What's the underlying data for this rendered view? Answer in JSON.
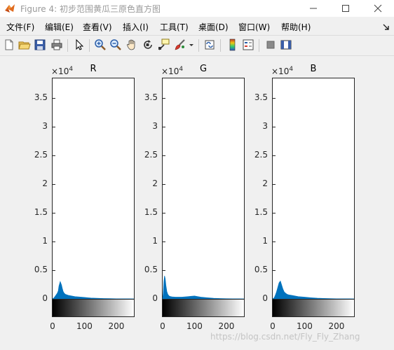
{
  "window": {
    "title": "Figure 4: 初步范围黄瓜三原色直方图"
  },
  "menu": [
    {
      "label": "文件(F)"
    },
    {
      "label": "编辑(E)"
    },
    {
      "label": "查看(V)"
    },
    {
      "label": "插入(I)"
    },
    {
      "label": "工具(T)"
    },
    {
      "label": "桌面(D)"
    },
    {
      "label": "窗口(W)"
    },
    {
      "label": "帮助(H)"
    }
  ],
  "toolbar": {
    "icons": [
      "new-figure-icon",
      "open-file-icon",
      "save-icon",
      "print-icon",
      "pointer-icon",
      "zoom-in-icon",
      "zoom-out-icon",
      "pan-icon",
      "rotate-3d-icon",
      "data-cursor-icon",
      "brush-icon",
      "dropdown-arrow-icon",
      "link-plot-icon",
      "colorbar-icon",
      "legend-icon",
      "hide-plot-tools-icon",
      "show-plot-tools-icon"
    ]
  },
  "chart_data": [
    {
      "type": "area",
      "title": "R",
      "y_multiplier": "×10",
      "y_exponent": "4",
      "yticks": [
        "0",
        "0.5",
        "1",
        "1.5",
        "2",
        "2.5",
        "3",
        "3.5"
      ],
      "xticks": [
        "0",
        "100",
        "200"
      ],
      "xlim": [
        0,
        255
      ],
      "ylim": [
        0,
        3.85
      ],
      "color": "#0072bd",
      "x": [
        0,
        5,
        10,
        15,
        18,
        20,
        24,
        28,
        30,
        33,
        36,
        40,
        45,
        50,
        60,
        70,
        80,
        90,
        100,
        120,
        140,
        160,
        180,
        200,
        220,
        240,
        255
      ],
      "values": [
        0.0,
        0.02,
        0.06,
        0.1,
        0.14,
        0.22,
        0.3,
        0.24,
        0.19,
        0.13,
        0.1,
        0.08,
        0.07,
        0.06,
        0.05,
        0.04,
        0.035,
        0.03,
        0.025,
        0.015,
        0.01,
        0.006,
        0.004,
        0.002,
        0.001,
        0.001,
        0.0
      ]
    },
    {
      "type": "area",
      "title": "G",
      "y_multiplier": "×10",
      "y_exponent": "4",
      "yticks": [
        "0",
        "0.5",
        "1",
        "1.5",
        "2",
        "2.5",
        "3",
        "3.5"
      ],
      "xticks": [
        "0",
        "100",
        "200"
      ],
      "xlim": [
        0,
        255
      ],
      "ylim": [
        0,
        3.85
      ],
      "color": "#0072bd",
      "x": [
        0,
        2,
        4,
        6,
        8,
        10,
        13,
        16,
        20,
        25,
        30,
        40,
        50,
        60,
        70,
        80,
        90,
        100,
        110,
        120,
        140,
        160,
        180,
        200,
        220,
        240,
        255
      ],
      "values": [
        0.0,
        0.1,
        0.3,
        0.4,
        0.35,
        0.24,
        0.13,
        0.08,
        0.05,
        0.04,
        0.035,
        0.03,
        0.03,
        0.03,
        0.035,
        0.04,
        0.045,
        0.05,
        0.04,
        0.03,
        0.02,
        0.01,
        0.006,
        0.003,
        0.002,
        0.001,
        0.0
      ]
    },
    {
      "type": "area",
      "title": "B",
      "y_multiplier": "×10",
      "y_exponent": "4",
      "yticks": [
        "0",
        "0.5",
        "1",
        "1.5",
        "2",
        "2.5",
        "3",
        "3.5"
      ],
      "xticks": [
        "0",
        "100",
        "200"
      ],
      "xlim": [
        0,
        255
      ],
      "ylim": [
        0,
        3.85
      ],
      "color": "#0072bd",
      "x": [
        0,
        5,
        8,
        12,
        16,
        20,
        24,
        28,
        32,
        36,
        40,
        45,
        50,
        60,
        70,
        80,
        90,
        100,
        120,
        140,
        160,
        180,
        200,
        220,
        240,
        255
      ],
      "values": [
        0.0,
        0.02,
        0.06,
        0.12,
        0.2,
        0.28,
        0.31,
        0.24,
        0.17,
        0.12,
        0.1,
        0.08,
        0.07,
        0.06,
        0.05,
        0.04,
        0.035,
        0.03,
        0.02,
        0.012,
        0.007,
        0.004,
        0.002,
        0.001,
        0.001,
        0.0
      ]
    }
  ],
  "watermark": "https://blog.csdn.net/Fly_Fly_Zhang"
}
